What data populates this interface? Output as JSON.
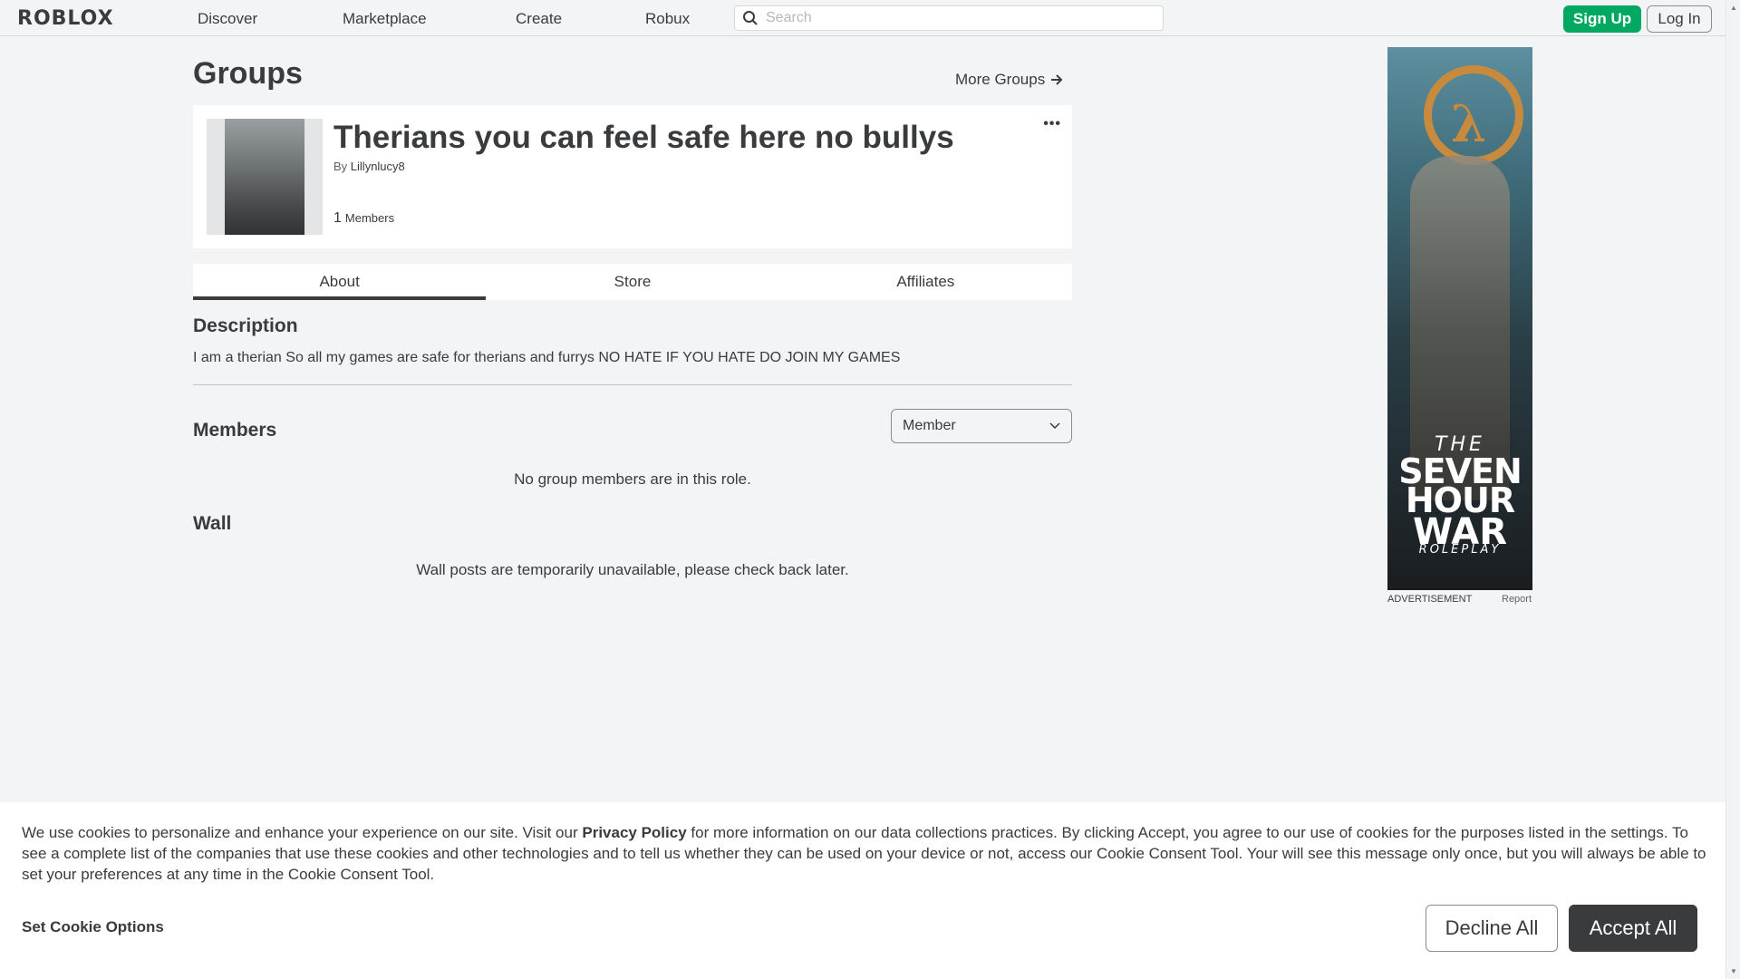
{
  "header": {
    "logo": "ROBLOX",
    "nav": [
      "Discover",
      "Marketplace",
      "Create",
      "Robux"
    ],
    "search_placeholder": "Search",
    "signup_label": "Sign Up",
    "login_label": "Log In"
  },
  "page": {
    "title": "Groups",
    "more_groups_label": "More Groups"
  },
  "group": {
    "name": "Therians you can feel safe here no bullys",
    "by_prefix": "By",
    "owner": "Lillynlucy8",
    "member_count": "1",
    "members_label": "Members",
    "more_icon": "ellipsis-icon"
  },
  "tabs": [
    "About",
    "Store",
    "Affiliates"
  ],
  "active_tab": "About",
  "description": {
    "heading": "Description",
    "text": "I am a therian So all my games are safe for therians and furrys NO HATE IF YOU HATE DO JOIN MY GAMES"
  },
  "members": {
    "heading": "Members",
    "role_selected": "Member",
    "empty_message": "No group members are in this role."
  },
  "wall": {
    "heading": "Wall",
    "message": "Wall posts are temporarily unavailable, please check back later."
  },
  "ad": {
    "line1": "THE",
    "line2": "SEVEN",
    "line3": "HOUR",
    "line4": "WAR",
    "line5": "ROLEPLAY",
    "label": "ADVERTISEMENT",
    "report": "Report"
  },
  "cookie": {
    "text_before": "We use cookies to personalize and enhance your experience on our site. Visit our ",
    "privacy_link": "Privacy Policy",
    "text_after": " for more information on our data collections practices. By clicking Accept, you agree to our use of cookies for the purposes listed in the settings. To see a complete list of the companies that use these cookies and other technologies and to tell us whether they can be used on your device or not, access our Cookie Consent Tool. Your will see this message only once, but you will always be able to set your preferences at any time in the Cookie Consent Tool.",
    "options_label": "Set Cookie Options",
    "decline_label": "Decline All",
    "accept_label": "Accept All"
  },
  "colors": {
    "accent_green": "#00a862",
    "text_dark": "#393b3d",
    "background": "#f2f4f5"
  }
}
